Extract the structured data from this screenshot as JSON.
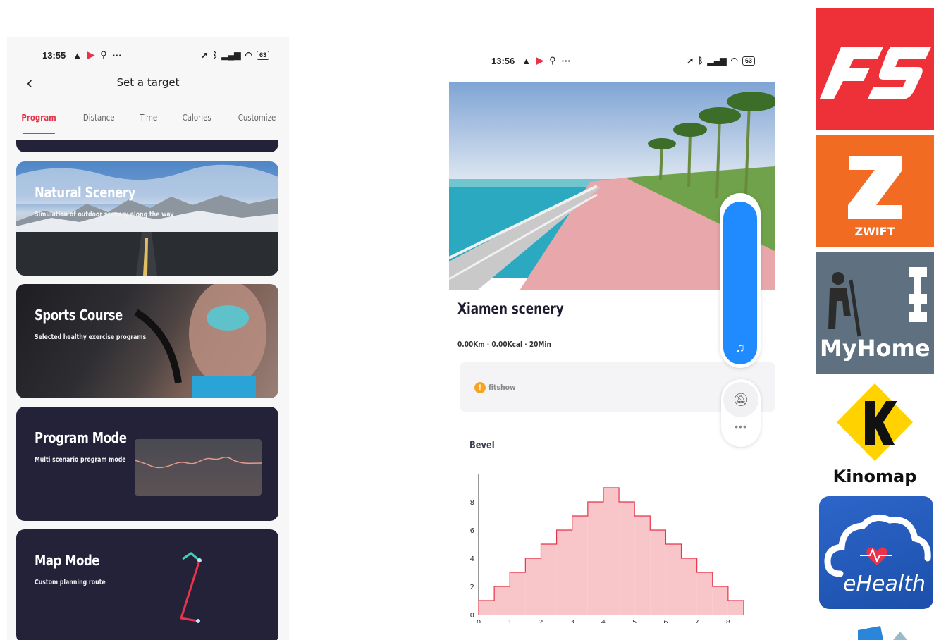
{
  "phone1": {
    "status": {
      "time": "13:55",
      "battery": "63"
    },
    "title": "Set a target",
    "tabs": [
      "Program",
      "Distance",
      "Time",
      "Calories",
      "Customize"
    ],
    "active_tab": "Program",
    "cards": [
      {
        "title": "Natural Scenery",
        "subtitle": "Simulation of outdoor scenery along the way"
      },
      {
        "title": "Sports Course",
        "subtitle": "Selected healthy exercise programs"
      },
      {
        "title": "Program Mode",
        "subtitle": "Multi scenario program mode"
      },
      {
        "title": "Map Mode",
        "subtitle": "Custom planning route"
      }
    ]
  },
  "phone2": {
    "status": {
      "time": "13:56",
      "battery": "63"
    },
    "scenery_title": "Xiamen scenery",
    "stats": "0.00Km · 0.00Kcal · 20Min",
    "source": "fitshow",
    "chart_label": "Bevel",
    "volume_level": 0.97
  },
  "apps": [
    {
      "name": "FS",
      "color": "#ee3038"
    },
    {
      "name": "ZWIFT",
      "color": "#f26b22"
    },
    {
      "name": "MyHome FIT",
      "color": "#5f7181"
    },
    {
      "name": "Kinomap",
      "color": "#ffd200"
    },
    {
      "name": "eHealth",
      "color": "#2d66c9"
    }
  ],
  "chart_data": {
    "type": "area",
    "step": true,
    "title": "Bevel",
    "x": [
      0,
      0.5,
      1,
      1.5,
      2,
      2.5,
      3,
      3.5,
      4,
      4.5,
      5,
      5.5,
      6,
      6.5,
      7,
      7.5,
      8
    ],
    "values": [
      1,
      2,
      3,
      4,
      5,
      6,
      7,
      8,
      9,
      8,
      7,
      6,
      5,
      4,
      3,
      2,
      1
    ],
    "x_end": 8.5,
    "xticks": [
      "0",
      "1",
      "2",
      "3",
      "4",
      "5",
      "6",
      "7",
      "8"
    ],
    "yticks": [
      "0",
      "2",
      "4",
      "6",
      "8"
    ],
    "xlim": [
      0,
      8.5
    ],
    "ylim": [
      0,
      10
    ],
    "grid": false,
    "fill_color": "#f8c5c9",
    "line_color": "#e8344b"
  }
}
